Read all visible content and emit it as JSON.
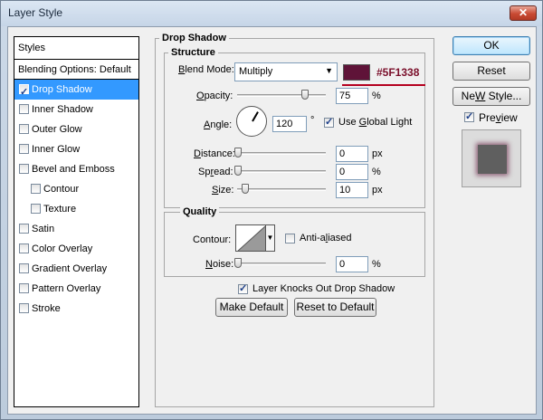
{
  "window": {
    "title": "Layer Style",
    "close_glyph": "✕"
  },
  "styles_list": {
    "header": "Styles",
    "blending_options": "Blending Options: Default",
    "items": [
      {
        "label": "Drop Shadow",
        "checked": true,
        "selected": true,
        "indent": false
      },
      {
        "label": "Inner Shadow",
        "checked": false,
        "selected": false,
        "indent": false
      },
      {
        "label": "Outer Glow",
        "checked": false,
        "selected": false,
        "indent": false
      },
      {
        "label": "Inner Glow",
        "checked": false,
        "selected": false,
        "indent": false
      },
      {
        "label": "Bevel and Emboss",
        "checked": false,
        "selected": false,
        "indent": false
      },
      {
        "label": "Contour",
        "checked": false,
        "selected": false,
        "indent": true
      },
      {
        "label": "Texture",
        "checked": false,
        "selected": false,
        "indent": true
      },
      {
        "label": "Satin",
        "checked": false,
        "selected": false,
        "indent": false
      },
      {
        "label": "Color Overlay",
        "checked": false,
        "selected": false,
        "indent": false
      },
      {
        "label": "Gradient Overlay",
        "checked": false,
        "selected": false,
        "indent": false
      },
      {
        "label": "Pattern Overlay",
        "checked": false,
        "selected": false,
        "indent": false
      },
      {
        "label": "Stroke",
        "checked": false,
        "selected": false,
        "indent": false
      }
    ]
  },
  "drop_shadow": {
    "title": "Drop Shadow",
    "structure": {
      "title": "Structure",
      "blend_mode_label_u": "B",
      "blend_mode_label_rest": "lend Mode:",
      "blend_mode_value": "Multiply",
      "color_hex": "#5F1338",
      "color_swatch": "#5f1338",
      "opacity_label_u": "O",
      "opacity_label_rest": "pacity:",
      "opacity_value": "75",
      "opacity_unit": "%",
      "opacity_fraction": 0.75,
      "angle_label_u": "A",
      "angle_label_rest": "ngle:",
      "angle_value": "120",
      "angle_unit": "°",
      "use_global_light_pre": "Use ",
      "use_global_light_u": "G",
      "use_global_light_rest": "lobal Light",
      "use_global_light_checked": true,
      "distance_label_u": "D",
      "distance_label_rest": "istance:",
      "distance_value": "0",
      "distance_unit": "px",
      "spread_label_pre": "Sp",
      "spread_label_u": "r",
      "spread_label_rest": "ead:",
      "spread_value": "0",
      "spread_unit": "%",
      "size_label_u": "S",
      "size_label_rest": "ize:",
      "size_value": "10",
      "size_unit": "px"
    },
    "quality": {
      "title": "Quality",
      "contour_label": "Contour:",
      "anti_aliased_pre": "Anti-a",
      "anti_aliased_u": "l",
      "anti_aliased_rest": "iased",
      "anti_aliased_checked": false,
      "noise_label_u": "N",
      "noise_label_rest": "oise:",
      "noise_value": "0",
      "noise_unit": "%"
    },
    "layer_knocks_out": {
      "label": "Layer Knocks Out Drop Shadow",
      "checked": true
    },
    "make_default_label": "Make Default",
    "reset_default_label": "Reset to Default"
  },
  "buttons": {
    "ok": "OK",
    "reset": "Reset",
    "new_style_u": "W",
    "new_style_pre": "Ne",
    "new_style_rest": " Style...",
    "preview_pre": "Pre",
    "preview_u": "v",
    "preview_rest": "iew",
    "preview_checked": true
  },
  "colors": {
    "selection": "#3399ff",
    "shadow_color": "#5f1338",
    "annotation_red": "#b4001f"
  }
}
